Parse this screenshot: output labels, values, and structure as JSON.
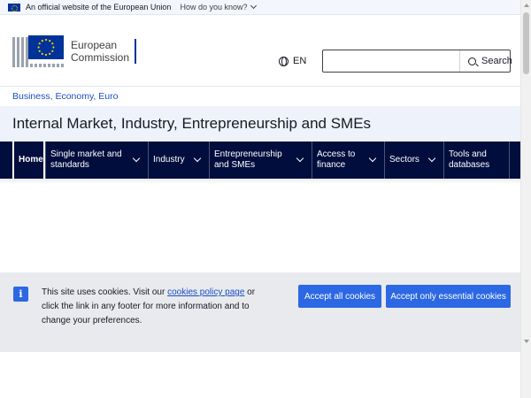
{
  "topbar": {
    "official_text": "An official website of the European Union",
    "how_text": "How do you know?"
  },
  "header": {
    "logo_line1": "European",
    "logo_line2": "Commission",
    "language": "EN",
    "search_placeholder": "",
    "search_button": "Search"
  },
  "breadcrumb": {
    "items": [
      "Business, Economy, Euro"
    ]
  },
  "site_title": "Internal Market, Industry, Entrepreneurship and SMEs",
  "menu": {
    "items": [
      {
        "label": "Home"
      },
      {
        "label": "Single market and standards"
      },
      {
        "label": "Industry"
      },
      {
        "label": "Entrepreneurship and SMEs"
      },
      {
        "label": "Access to finance"
      },
      {
        "label": "Sectors"
      },
      {
        "label": "Tools and databases"
      }
    ]
  },
  "cookie": {
    "text_before": "This site uses cookies. Visit our ",
    "link_text": "cookies policy page",
    "text_after": " or click the link in any footer for more information and to change your preferences.",
    "accept_all": "Accept all cookies",
    "accept_essential": "Accept only essential cookies"
  },
  "colors": {
    "menu_bg": "#000d3d",
    "title_bg": "#eef2fb",
    "button_blue": "#2c68e3",
    "link_blue": "#1a4ec5",
    "cookie_bg": "#e8eaee"
  }
}
